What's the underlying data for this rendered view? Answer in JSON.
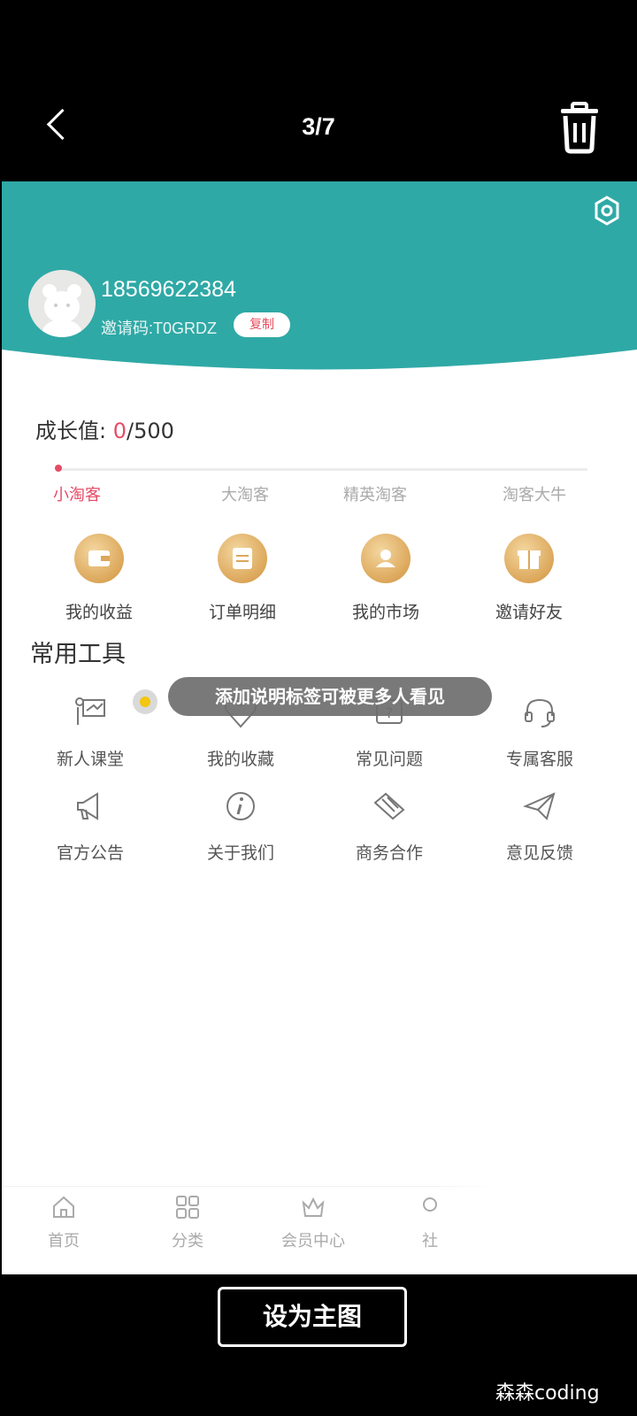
{
  "viewer": {
    "counter": "3/7",
    "set_main_label": "设为主图",
    "watermark": "森森coding"
  },
  "profile": {
    "phone": "18569622384",
    "invite_code": "邀请码:T0GRDZ",
    "copy_label": "复制"
  },
  "growth": {
    "label": "成长值: ",
    "current": "0",
    "max": "/500",
    "progress_fraction": 0,
    "levels": [
      "小淘客",
      "大淘客",
      "精英淘客",
      "淘客大牛"
    ]
  },
  "quick_actions": [
    {
      "label": "我的收益",
      "icon": "wallet-icon"
    },
    {
      "label": "订单明细",
      "icon": "order-icon"
    },
    {
      "label": "我的市场",
      "icon": "market-icon"
    },
    {
      "label": "邀请好友",
      "icon": "gift-icon"
    }
  ],
  "tools": {
    "title": "常用工具",
    "items": [
      {
        "label": "新人课堂",
        "icon": "classroom-icon"
      },
      {
        "label": "我的收藏",
        "icon": "heart-icon"
      },
      {
        "label": "常见问题",
        "icon": "question-icon"
      },
      {
        "label": "专属客服",
        "icon": "headset-icon"
      },
      {
        "label": "官方公告",
        "icon": "megaphone-icon"
      },
      {
        "label": "关于我们",
        "icon": "info-icon"
      },
      {
        "label": "商务合作",
        "icon": "handshake-icon"
      },
      {
        "label": "意见反馈",
        "icon": "paper-plane-icon"
      }
    ]
  },
  "tooltip": {
    "text": "添加说明标签可被更多人看见"
  },
  "tabbar": [
    {
      "label": "首页",
      "icon": "home-icon"
    },
    {
      "label": "分类",
      "icon": "grid-icon"
    },
    {
      "label": "会员中心",
      "icon": "crown-icon"
    },
    {
      "label": "社",
      "icon": "community-icon"
    }
  ],
  "colors": {
    "header_teal": "#2fa9a6",
    "accent_pink": "#e64b66",
    "gold": "#dca75a"
  }
}
